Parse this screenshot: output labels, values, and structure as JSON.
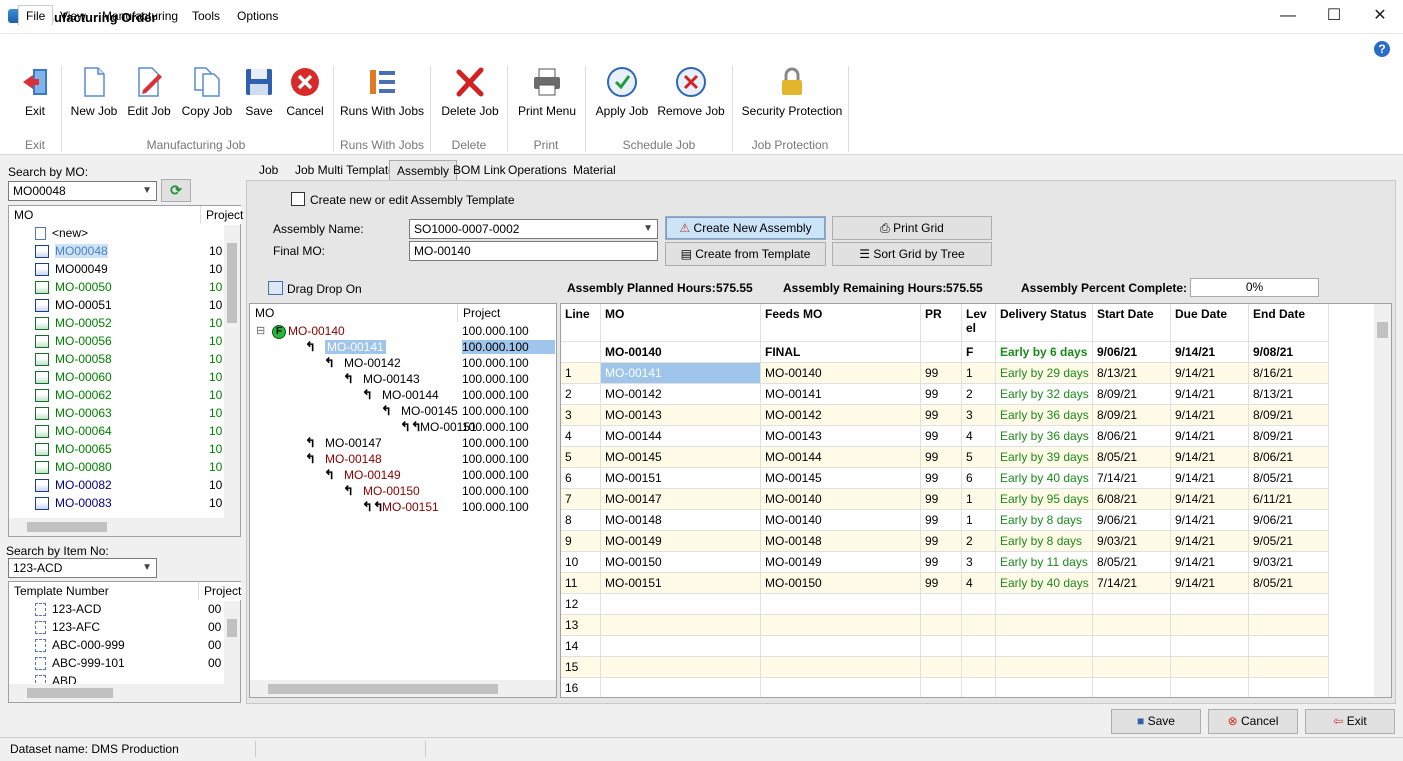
{
  "window": {
    "title": "Manufacturing Order",
    "minimize": "—",
    "maximize": "☐",
    "close": "✕"
  },
  "menu": [
    "File",
    "View",
    "Manufacturing",
    "Tools",
    "Options"
  ],
  "ribbon": {
    "buttons": [
      "Exit",
      "New Job",
      "Edit Job",
      "Copy Job",
      "Save",
      "Cancel",
      "Runs With Jobs",
      "Delete Job",
      "Print Menu",
      "Apply Job",
      "Remove Job",
      "Security Protection"
    ],
    "groups": [
      "Exit",
      "Manufacturing Job",
      "Runs With Jobs",
      "Delete",
      "Print",
      "Schedule Job",
      "Job Protection"
    ]
  },
  "left": {
    "search_mo_label": "Search by MO:",
    "search_mo_value": "MO00048",
    "mo_list_headers": [
      "MO",
      "Project"
    ],
    "mo_list": [
      {
        "mo": "<new>",
        "project": "",
        "color": "black",
        "icon": "doc"
      },
      {
        "mo": "MO00048",
        "project": "10",
        "color": "navy",
        "icon": "mo",
        "selected": true
      },
      {
        "mo": "MO00049",
        "project": "10",
        "color": "black",
        "icon": "mo"
      },
      {
        "mo": "MO-00050",
        "project": "10",
        "color": "green",
        "icon": "mog"
      },
      {
        "mo": "MO-00051",
        "project": "10",
        "color": "black",
        "icon": "mo"
      },
      {
        "mo": "MO-00052",
        "project": "10",
        "color": "green",
        "icon": "mog"
      },
      {
        "mo": "MO-00056",
        "project": "10",
        "color": "green",
        "icon": "mog"
      },
      {
        "mo": "MO-00058",
        "project": "10",
        "color": "green",
        "icon": "mog"
      },
      {
        "mo": "MO-00060",
        "project": "10",
        "color": "green",
        "icon": "mog"
      },
      {
        "mo": "MO-00062",
        "project": "10",
        "color": "green",
        "icon": "mog"
      },
      {
        "mo": "MO-00063",
        "project": "10",
        "color": "green",
        "icon": "mog"
      },
      {
        "mo": "MO-00064",
        "project": "10",
        "color": "green",
        "icon": "mog"
      },
      {
        "mo": "MO-00065",
        "project": "10",
        "color": "green",
        "icon": "mog"
      },
      {
        "mo": "MO-00080",
        "project": "10",
        "color": "green",
        "icon": "mog"
      },
      {
        "mo": "MO-00082",
        "project": "10",
        "color": "navy",
        "icon": "mo"
      },
      {
        "mo": "MO-00083",
        "project": "10",
        "color": "navy",
        "icon": "mo"
      }
    ],
    "search_item_label": "Search by Item No:",
    "search_item_value": "123-ACD",
    "template_headers": [
      "Template Number",
      "Project"
    ],
    "templates": [
      {
        "name": "123-ACD",
        "project": "00"
      },
      {
        "name": "123-AFC",
        "project": "00"
      },
      {
        "name": "ABC-000-999",
        "project": "00"
      },
      {
        "name": "ABC-999-101",
        "project": "00"
      },
      {
        "name": "ABD",
        "project": ""
      }
    ]
  },
  "tabs": [
    "Job",
    "Job Multi Template",
    "Assembly",
    "BOM Link",
    "Operations",
    "Material"
  ],
  "assembly": {
    "template_checkbox": "Create new or edit Assembly Template",
    "name_label": "Assembly Name:",
    "name_value": "SO1000-0007-0002",
    "final_mo_label": "Final MO:",
    "final_mo_value": "MO-00140",
    "btn_create_new": "Create New Assembly",
    "btn_create_template": "Create from Template",
    "btn_print_grid": "Print Grid",
    "btn_sort_tree": "Sort Grid by Tree",
    "drag_drop": "Drag Drop On",
    "planned_label": "Assembly Planned Hours:",
    "planned_value": "575.55",
    "remaining_label": "Assembly Remaining Hours:",
    "remaining_value": "575.55",
    "percent_label": "Assembly Percent Complete:",
    "percent_value": "0%"
  },
  "tree": {
    "headers": [
      "MO",
      "Project"
    ],
    "rows": [
      {
        "mo": "MO-00140",
        "project": "100.000.100",
        "indent": 0,
        "color": "maroon",
        "root": true
      },
      {
        "mo": "MO-00141",
        "project": "100.000.100",
        "indent": 1,
        "color": "white",
        "selected": true
      },
      {
        "mo": "MO-00142",
        "project": "100.000.100",
        "indent": 2,
        "color": "black"
      },
      {
        "mo": "MO-00143",
        "project": "100.000.100",
        "indent": 3,
        "color": "black"
      },
      {
        "mo": "MO-00144",
        "project": "100.000.100",
        "indent": 4,
        "color": "black"
      },
      {
        "mo": "MO-00145",
        "project": "100.000.100",
        "indent": 5,
        "color": "black"
      },
      {
        "mo": "MO-00151",
        "project": "100.000.100",
        "indent": 6,
        "color": "black"
      },
      {
        "mo": "MO-00147",
        "project": "100.000.100",
        "indent": 1,
        "color": "black"
      },
      {
        "mo": "MO-00148",
        "project": "100.000.100",
        "indent": 1,
        "color": "maroon"
      },
      {
        "mo": "MO-00149",
        "project": "100.000.100",
        "indent": 2,
        "color": "maroon"
      },
      {
        "mo": "MO-00150",
        "project": "100.000.100",
        "indent": 3,
        "color": "maroon"
      },
      {
        "mo": "MO-00151",
        "project": "100.000.100",
        "indent": 4,
        "color": "maroon"
      }
    ]
  },
  "grid": {
    "headers": [
      "Line",
      "MO",
      "Feeds MO",
      "PR",
      "Level",
      "Delivery Status",
      "Start Date",
      "Due Date",
      "End Date"
    ],
    "summary": {
      "mo": "MO-00140",
      "feeds": "FINAL",
      "level": "F",
      "status": "Early by 6 days",
      "start": "9/06/21",
      "due": "9/14/21",
      "end": "9/08/21"
    },
    "rows": [
      [
        "1",
        "MO-00141",
        "MO-00140",
        "99",
        "1",
        "Early by 29 days",
        "8/13/21",
        "9/14/21",
        "8/16/21"
      ],
      [
        "2",
        "MO-00142",
        "MO-00141",
        "99",
        "2",
        "Early by 32 days",
        "8/09/21",
        "9/14/21",
        "8/13/21"
      ],
      [
        "3",
        "MO-00143",
        "MO-00142",
        "99",
        "3",
        "Early by 36 days",
        "8/09/21",
        "9/14/21",
        "8/09/21"
      ],
      [
        "4",
        "MO-00144",
        "MO-00143",
        "99",
        "4",
        "Early by 36 days",
        "8/06/21",
        "9/14/21",
        "8/09/21"
      ],
      [
        "5",
        "MO-00145",
        "MO-00144",
        "99",
        "5",
        "Early by 39 days",
        "8/05/21",
        "9/14/21",
        "8/06/21"
      ],
      [
        "6",
        "MO-00151",
        "MO-00145",
        "99",
        "6",
        "Early by 40 days",
        "7/14/21",
        "9/14/21",
        "8/05/21"
      ],
      [
        "7",
        "MO-00147",
        "MO-00140",
        "99",
        "1",
        "Early by 95 days",
        "6/08/21",
        "9/14/21",
        "6/11/21"
      ],
      [
        "8",
        "MO-00148",
        "MO-00140",
        "99",
        "1",
        "Early by 8 days",
        "9/06/21",
        "9/14/21",
        "9/06/21"
      ],
      [
        "9",
        "MO-00149",
        "MO-00148",
        "99",
        "2",
        "Early by 8 days",
        "9/03/21",
        "9/14/21",
        "9/05/21"
      ],
      [
        "10",
        "MO-00150",
        "MO-00149",
        "99",
        "3",
        "Early by 11 days",
        "8/05/21",
        "9/14/21",
        "9/03/21"
      ],
      [
        "11",
        "MO-00151",
        "MO-00150",
        "99",
        "4",
        "Early by 40 days",
        "7/14/21",
        "9/14/21",
        "8/05/21"
      ],
      [
        "12",
        "",
        "",
        "",
        "",
        "",
        "",
        "",
        ""
      ],
      [
        "13",
        "",
        "",
        "",
        "",
        "",
        "",
        "",
        ""
      ],
      [
        "14",
        "",
        "",
        "",
        "",
        "",
        "",
        "",
        ""
      ],
      [
        "15",
        "",
        "",
        "",
        "",
        "",
        "",
        "",
        ""
      ],
      [
        "16",
        "",
        "",
        "",
        "",
        "",
        "",
        "",
        ""
      ]
    ]
  },
  "footer": {
    "save": "Save",
    "cancel": "Cancel",
    "exit": "Exit"
  },
  "status": {
    "dataset": "Dataset name:  DMS Production"
  }
}
